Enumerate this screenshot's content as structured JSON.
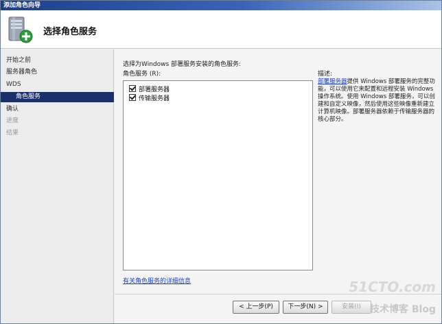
{
  "window": {
    "title": "添加角色向导"
  },
  "header": {
    "title": "选择角色服务",
    "icon": "server-add-icon"
  },
  "nav": {
    "items": [
      {
        "label": "开始之前",
        "state": "normal"
      },
      {
        "label": "服务器角色",
        "state": "normal"
      },
      {
        "label": "WDS",
        "state": "normal"
      },
      {
        "label": "角色服务",
        "state": "selected"
      },
      {
        "label": "确认",
        "state": "normal"
      },
      {
        "label": "进度",
        "state": "disabled"
      },
      {
        "label": "结果",
        "state": "disabled"
      }
    ]
  },
  "main": {
    "instruction": "选择为Windows 部署服务安装的角色服务:",
    "list_label": "角色服务 (R):",
    "role_services": [
      {
        "label": "部署服务器",
        "checked": true
      },
      {
        "label": "传输服务器",
        "checked": true
      }
    ],
    "description_label": "描述:",
    "description_link": "部署服务器",
    "description_text": "提供 Windows 部署服务的完整功能，可以使用它来配置和远程安装 Windows 操作系统。使用 Windows 部署服务，可以创建和自定义映像，然后使用这些映像重新建立计算机映像。部署服务器依赖于传输服务器的核心部分。",
    "more_info_link": "有关角色服务的详细信息"
  },
  "buttons": {
    "back": "< 上一步(P)",
    "next": "下一步(N) >",
    "install": "安装(I)"
  },
  "watermark": {
    "logo": "51CTO.com",
    "sub": "技术博客 Blog"
  }
}
